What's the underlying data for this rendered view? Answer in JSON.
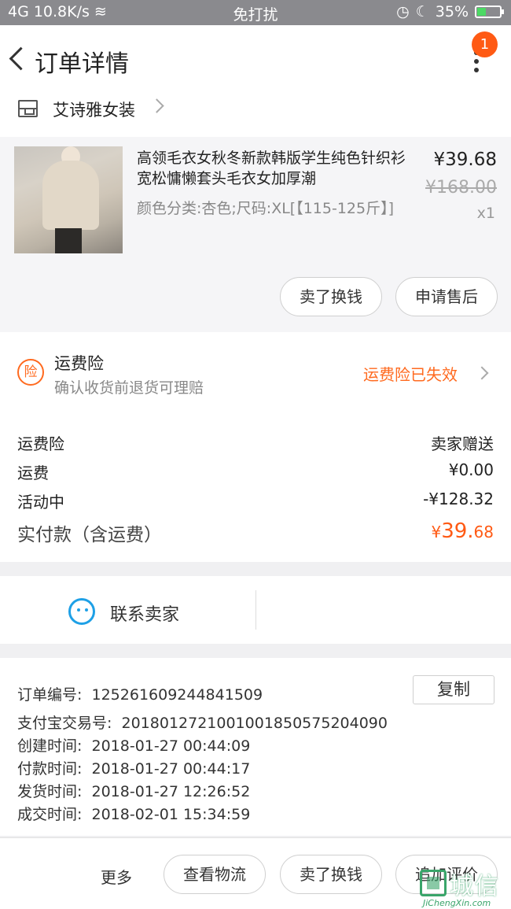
{
  "status_bar": {
    "signal": "4G",
    "net_speed": "10.8K/s",
    "mode": "免打扰",
    "battery": "35%"
  },
  "header": {
    "title": "订单详情",
    "badge_count": "1"
  },
  "shop": {
    "name": "艾诗雅女装"
  },
  "product": {
    "title": "高领毛衣女秋冬新款韩版学生纯色针织衫宽松慵懒套头毛衣女加厚潮",
    "spec": "颜色分类:杏色;尺码:XL[【115-125斤】]",
    "price": "¥39.68",
    "original_price": "¥168.00",
    "quantity": "x1",
    "btn_resell": "卖了换钱",
    "btn_after_sale": "申请售后"
  },
  "insurance": {
    "icon_text": "险",
    "title": "运费险",
    "subtitle": "确认收货前退货可理赔",
    "status": "运费险已失效"
  },
  "fees": {
    "rows": [
      {
        "label": "运费险",
        "value": "卖家赠送"
      },
      {
        "label": "运费",
        "value": "¥0.00"
      },
      {
        "label": "活动中",
        "value": "-¥128.32"
      }
    ],
    "total_label": "实付款（含运费）",
    "total_currency": "¥",
    "total_int": "39.",
    "total_dec": "68",
    "total_amount": 39.68
  },
  "contact": {
    "label": "联系卖家"
  },
  "order_info": {
    "order_no_label": "订单编号:",
    "order_no": "125261609244841509",
    "copy_label": "复制",
    "alipay_label": "支付宝交易号:",
    "alipay_no": "2018012721001001850575204090",
    "created_label": "创建时间:",
    "created": "2018-01-27 00:44:09",
    "paid_label": "付款时间:",
    "paid": "2018-01-27 00:44:17",
    "shipped_label": "发货时间:",
    "shipped": "2018-01-27 12:26:52",
    "completed_label": "成交时间:",
    "completed": "2018-02-01 15:34:59"
  },
  "bottom_bar": {
    "more": "更多",
    "btn_logistics": "查看物流",
    "btn_resell": "卖了换钱",
    "btn_review": "追加评价"
  },
  "watermark": {
    "text": "城信",
    "sub": "JiChengXin.com"
  },
  "colors": {
    "accent": "#ff5a14",
    "insurance_orange": "#ff6a1f",
    "chat_blue": "#1ea0e6"
  }
}
